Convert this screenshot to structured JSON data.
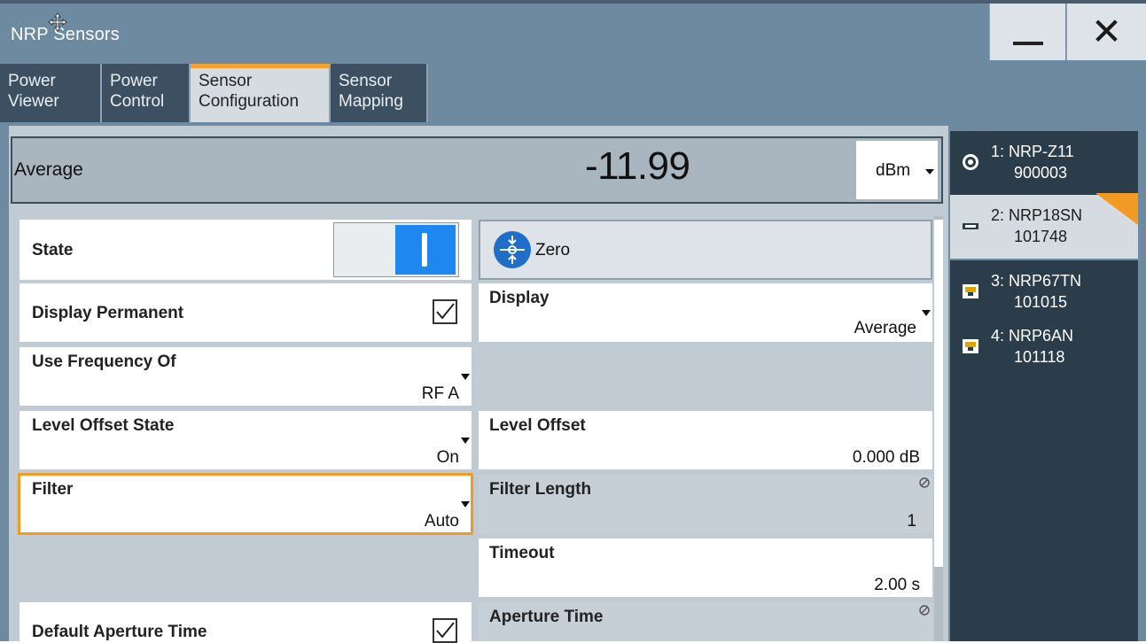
{
  "window": {
    "title": "NRP Sensors",
    "minimize_label": "—",
    "close_label": "✕"
  },
  "tabs": [
    {
      "line1": "Power",
      "line2": "Viewer",
      "active": false
    },
    {
      "line1": "Power",
      "line2": "Control",
      "active": false
    },
    {
      "line1": "Sensor",
      "line2": "Configuration",
      "active": true
    },
    {
      "line1": "Sensor",
      "line2": "Mapping",
      "active": false
    }
  ],
  "measurement": {
    "label": "Average",
    "value": "-11.99",
    "unit": "dBm"
  },
  "fields": {
    "state": {
      "label": "State",
      "on": true
    },
    "zero": {
      "label": "Zero"
    },
    "display_permanent": {
      "label": "Display Permanent",
      "checked": true
    },
    "display": {
      "label": "Display",
      "value": "Average"
    },
    "use_frequency_of": {
      "label": "Use Frequency Of",
      "value": "RF A"
    },
    "level_offset_state": {
      "label": "Level Offset State",
      "value": "On"
    },
    "level_offset": {
      "label": "Level Offset",
      "value": "0.000 dB"
    },
    "filter": {
      "label": "Filter",
      "value": "Auto"
    },
    "filter_length": {
      "label": "Filter Length",
      "value": "1"
    },
    "timeout": {
      "label": "Timeout",
      "value": "2.00 s"
    },
    "default_aperture_time": {
      "label": "Default Aperture Time",
      "checked": true
    },
    "aperture_time": {
      "label": "Aperture Time"
    }
  },
  "sensors": [
    {
      "line1": "1: NRP-Z11",
      "line2": "900003",
      "icon": "power-sensor-icon",
      "selected": false
    },
    {
      "line1": "2: NRP18SN",
      "line2": "101748",
      "icon": "usb-sensor-icon",
      "selected": true
    },
    {
      "line1": "3: NRP67TN",
      "line2": "101015",
      "icon": "lan-sensor-icon",
      "selected": false
    },
    {
      "line1": "4: NRP6AN",
      "line2": "101118",
      "icon": "lan-sensor-icon",
      "selected": false
    }
  ],
  "colors": {
    "accent": "#f39a24",
    "toggle_on": "#1e88f0",
    "frame": "#6d8aa1"
  }
}
